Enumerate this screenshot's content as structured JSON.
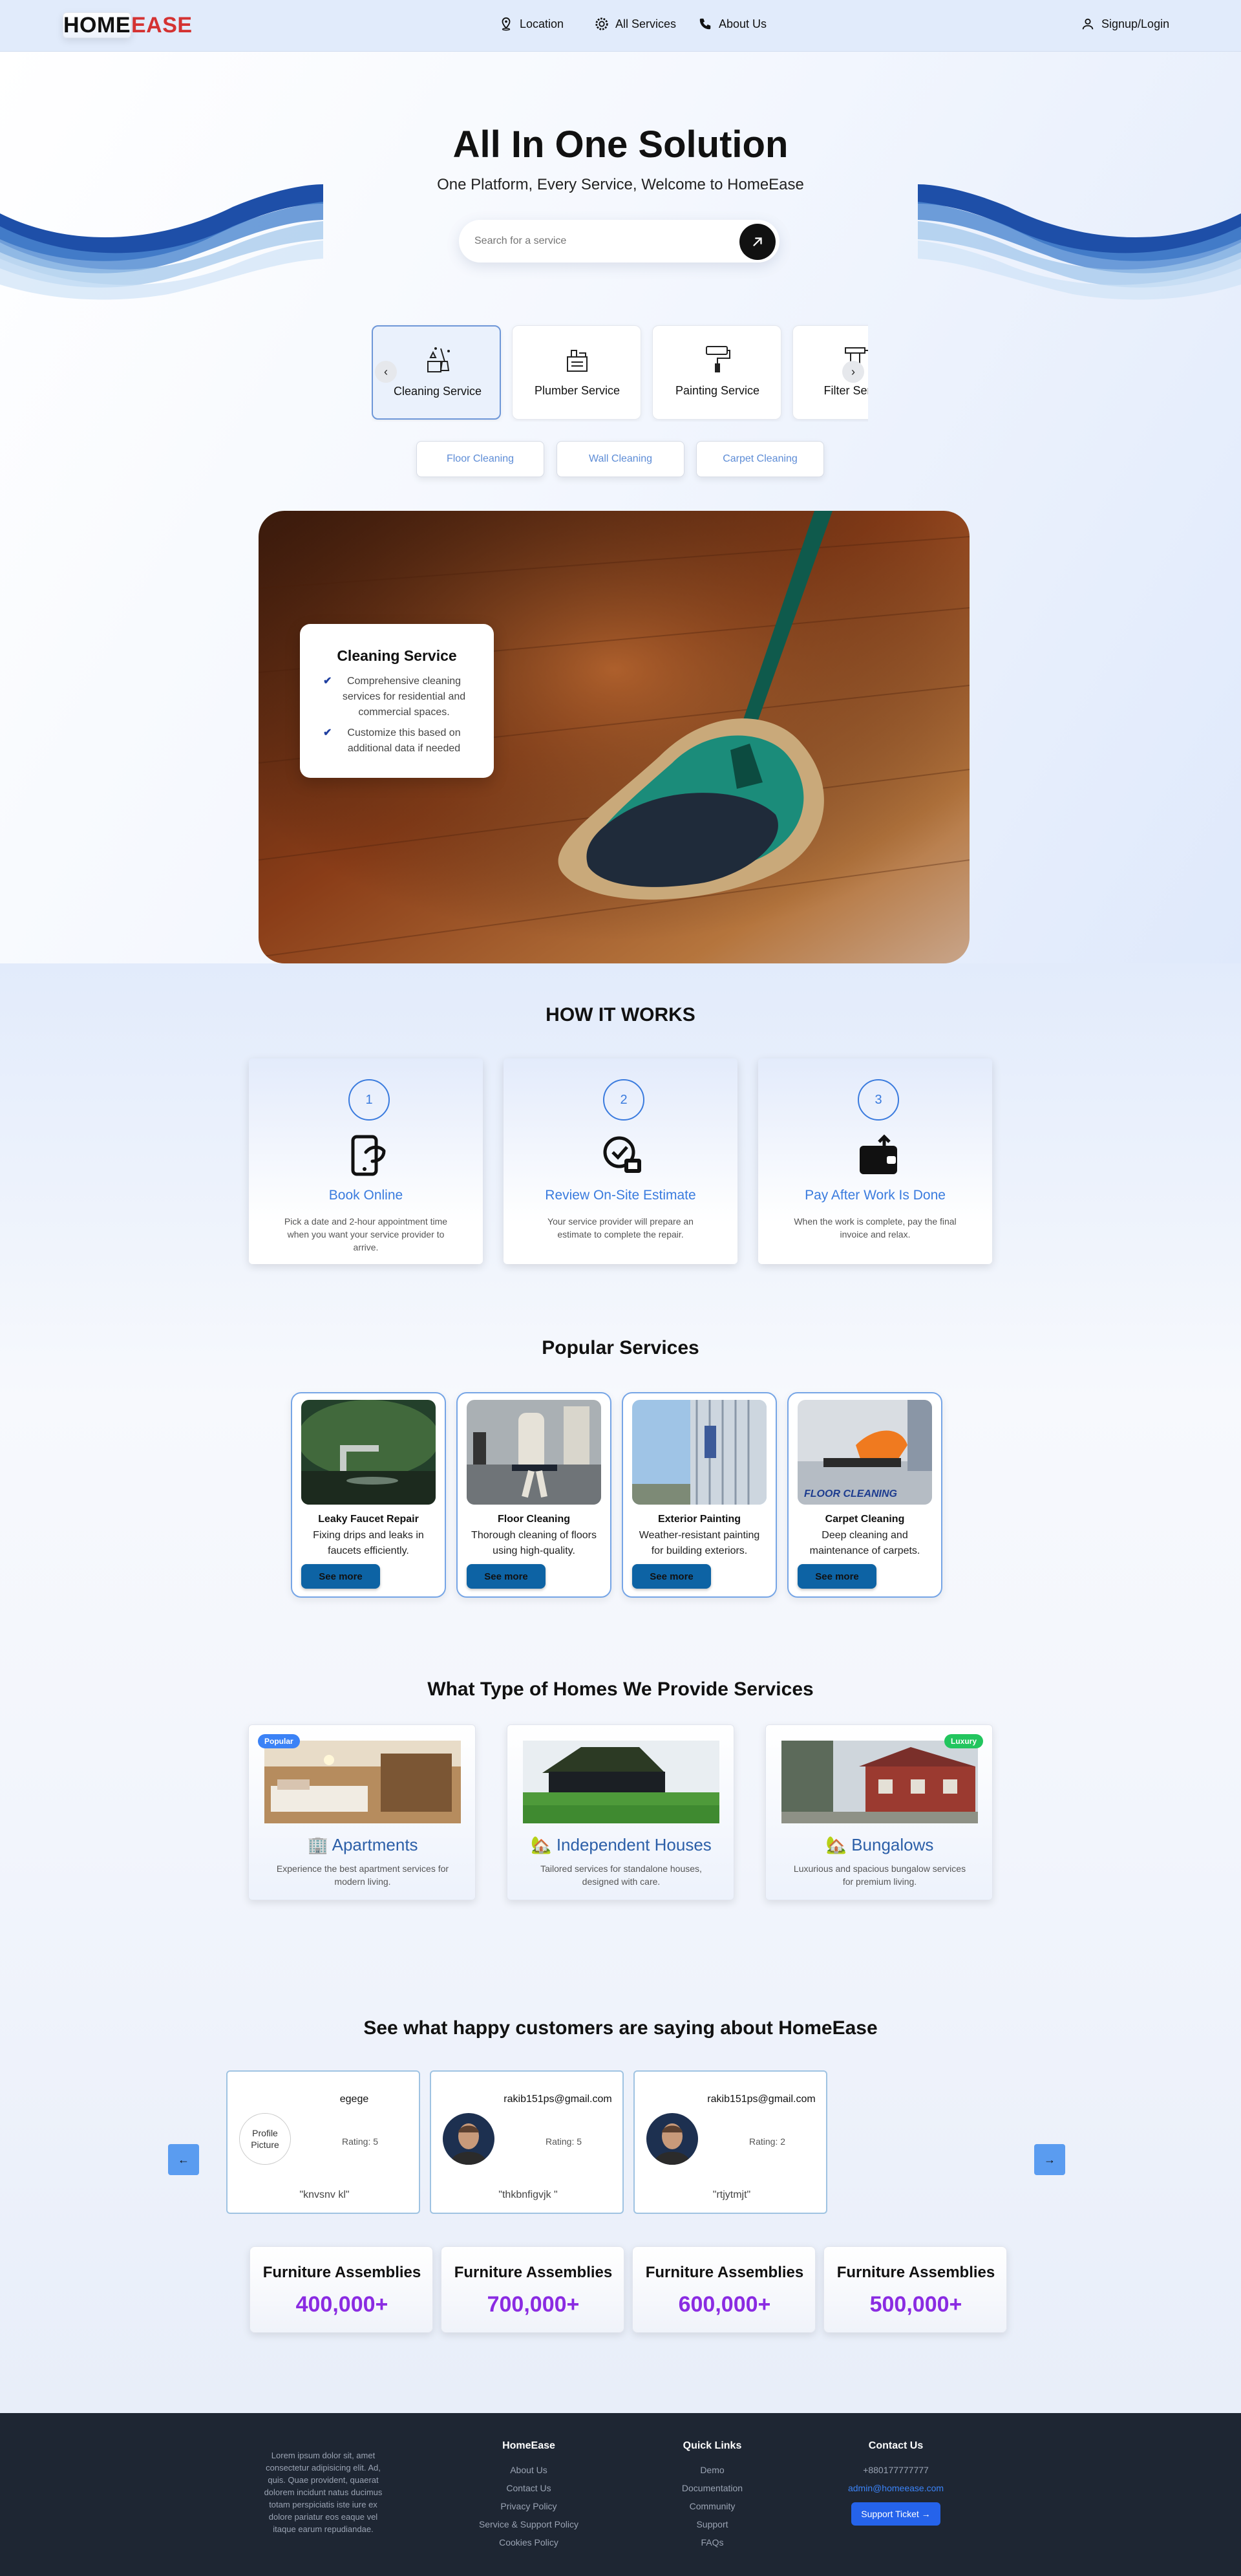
{
  "brand": {
    "part1": "HOME",
    "part2": "EASE"
  },
  "nav": {
    "links": [
      {
        "label": "Location",
        "icon": "location-pin-icon"
      },
      {
        "label": "All Services",
        "icon": "gear-icon"
      },
      {
        "label": "About Us",
        "icon": "phone-icon"
      }
    ],
    "signup": {
      "label": "Signup/Login",
      "icon": "user-icon"
    }
  },
  "hero": {
    "title": "All In One Solution",
    "subtitle": "One Platform, Every Service, Welcome to HomeEase",
    "search_placeholder": "Search for a service"
  },
  "services": [
    {
      "label": "Cleaning Service",
      "icon": "cleaning-icon",
      "active": true
    },
    {
      "label": "Plumber Service",
      "icon": "plumber-icon"
    },
    {
      "label": "Painting Service",
      "icon": "paint-roller-icon"
    },
    {
      "label": "Filter Service",
      "icon": "filter-icon"
    }
  ],
  "sub_services": [
    "Floor Cleaning",
    "Wall Cleaning",
    "Carpet Cleaning"
  ],
  "feature": {
    "title": "Cleaning Service",
    "points": [
      "Comprehensive cleaning services for residential and commercial spaces.",
      "Customize this based on additional data if needed"
    ]
  },
  "how": {
    "title": "HOW IT WORKS",
    "steps": [
      {
        "num": "1",
        "title": "Book Online",
        "desc": "Pick a date and 2-hour appointment time when you want your service provider to arrive.",
        "icon": "book-online-icon"
      },
      {
        "num": "2",
        "title": "Review On-Site Estimate",
        "desc": "Your service provider will prepare an estimate to complete the repair.",
        "icon": "estimate-icon"
      },
      {
        "num": "3",
        "title": "Pay After Work Is Done",
        "desc": "When the work is complete, pay the final invoice and relax.",
        "icon": "wallet-icon"
      }
    ]
  },
  "popular": {
    "title": "Popular Services",
    "button_label": "See more",
    "items": [
      {
        "title": "Leaky Faucet Repair",
        "desc": "Fixing drips and leaks in faucets efficiently."
      },
      {
        "title": "Floor Cleaning",
        "desc": "Thorough cleaning of floors using high-quality."
      },
      {
        "title": "Exterior Painting",
        "desc": "Weather-resistant painting for building exteriors."
      },
      {
        "title": "Carpet Cleaning",
        "desc": "Deep cleaning and maintenance of carpets.",
        "image_text": "FLOOR CLEANING"
      }
    ]
  },
  "homes": {
    "title": "What Type of Homes We Provide Services",
    "items": [
      {
        "emoji": "🏢",
        "title": "Apartments",
        "desc": "Experience the best apartment services for modern living.",
        "badge": "Popular",
        "badge_color": "#3b82f6"
      },
      {
        "emoji": "🏡",
        "title": "Independent Houses",
        "desc": "Tailored services for standalone houses, designed with care.",
        "badge": "",
        "badge_color": ""
      },
      {
        "emoji": "🏡",
        "title": "Bungalows",
        "desc": "Luxurious and spacious bungalow services for premium living.",
        "badge": "Luxury",
        "badge_color": "#22c55e"
      }
    ]
  },
  "testimonials": {
    "title": "See what happy customers are saying about HomeEase",
    "prev": "←",
    "next": "→",
    "items": [
      {
        "name": "egege",
        "rating": "Rating: 5",
        "quote": "\"knvsnv kl\"",
        "avatar_alt": "Profile Picture"
      },
      {
        "name": "rakib151ps@gmail.com",
        "rating": "Rating: 5",
        "quote": "\"thkbnfigvjk \""
      },
      {
        "name": "rakib151ps@gmail.com",
        "rating": "Rating: 2",
        "quote": "\"rtjytmjt\""
      }
    ]
  },
  "stats": [
    {
      "label": "Furniture Assemblies",
      "value": "400,000+"
    },
    {
      "label": "Furniture Assemblies",
      "value": "700,000+"
    },
    {
      "label": "Furniture Assemblies",
      "value": "600,000+"
    },
    {
      "label": "Furniture Assemblies",
      "value": "500,000+"
    }
  ],
  "footer": {
    "about": "Lorem ipsum dolor sit, amet consectetur adipisicing elit. Ad, quis. Quae provident, quaerat dolorem incidunt natus ducimus totam perspiciatis iste iure ex dolore pariatur eos eaque vel itaque earum repudiandae.",
    "col1": {
      "title": "HomeEase",
      "items": [
        "About Us",
        "Contact Us",
        "Privacy Policy",
        "Service & Support Policy",
        "Cookies Policy"
      ]
    },
    "col2": {
      "title": "Quick Links",
      "items": [
        "Demo",
        "Documentation",
        "Community",
        "Support",
        "FAQs"
      ]
    },
    "contact": {
      "title": "Contact Us",
      "phone": "+880177777777",
      "email": "admin@homeease.com",
      "button": "Support Ticket →"
    }
  },
  "colors": {
    "brand_red": "#d43232",
    "accent_blue": "#3a7bde",
    "stat_purple": "#8a2be2",
    "footer_bg": "#1e2633"
  }
}
